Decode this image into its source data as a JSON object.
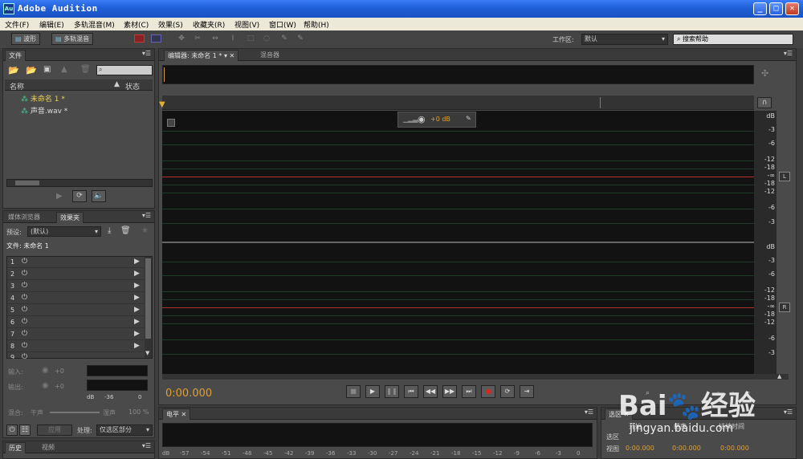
{
  "window": {
    "title": "Adobe Audition",
    "app_icon_text": "Au"
  },
  "menu": [
    "文件(F)",
    "编辑(E)",
    "多轨混音(M)",
    "素材(C)",
    "效果(S)",
    "收藏夹(R)",
    "视图(V)",
    "窗口(W)",
    "帮助(H)"
  ],
  "toolbar": {
    "waveform_label": "波形",
    "multitrack_label": "多轨混音",
    "workspace_label": "工作区:",
    "workspace_value": "默认",
    "search_placeholder": "搜索帮助"
  },
  "files_panel": {
    "tab": "文件",
    "col_name": "名称",
    "col_status": "状态",
    "items": [
      "未命名 1 *",
      "声音.wav *"
    ]
  },
  "effects_panel": {
    "tabs": [
      "媒体浏览器",
      "效果夹"
    ],
    "preset_label": "预设:",
    "preset_value": "(默认)",
    "file_label": "文件: 未命名 1",
    "slots": [
      "1",
      "2",
      "3",
      "4",
      "5",
      "6",
      "7",
      "8",
      "9"
    ],
    "input_label": "输入:",
    "output_label": "输出:",
    "input_value": "+0",
    "output_value": "+0",
    "scale": [
      "dB",
      "-36",
      "0"
    ],
    "mix_label": "混合:",
    "mix_dry": "干声",
    "mix_wet": "湿声",
    "mix_value": "100 %",
    "apply_label": "应用",
    "process_label": "处理:",
    "process_value": "仅选区部分"
  },
  "history_panel": {
    "tabs": [
      "历史",
      "视频"
    ]
  },
  "editor": {
    "tab_label": "编辑器: 未命名 1 *",
    "mixer_tab": "混音器",
    "gain_value": "+0 dB",
    "time": "0:00.000",
    "db_labels_top": [
      "dB",
      "-3",
      "-6",
      "-12",
      "-18",
      "-∞",
      "-18",
      "-12",
      "-6",
      "-3"
    ],
    "db_labels_bottom": [
      "dB",
      "-3",
      "-6",
      "-12",
      "-18",
      "-∞",
      "-18",
      "-12",
      "-6",
      "-3"
    ],
    "channel_l": "L",
    "channel_r": "R"
  },
  "levels_panel": {
    "tab": "电平",
    "scale": [
      "dB",
      "-57",
      "-54",
      "-51",
      "-48",
      "-45",
      "-42",
      "-39",
      "-36",
      "-33",
      "-30",
      "-27",
      "-24",
      "-21",
      "-18",
      "-15",
      "-12",
      "-9",
      "-6",
      "-3",
      "0"
    ]
  },
  "selection_panel": {
    "tab": "选区",
    "col_start": "开始",
    "col_end": "结束",
    "col_duration": "持续时间",
    "row_selection": "选区",
    "row_view": "视图",
    "start": "0:00.000",
    "end": "0:00.000",
    "duration": "0:00.000"
  },
  "watermark": "jingyan.baidu.com"
}
